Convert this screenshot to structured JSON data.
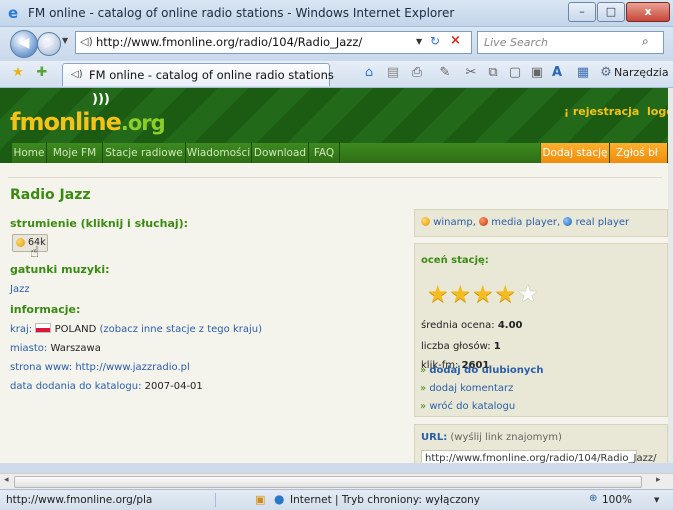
{
  "window": {
    "title": "FM online - catalog of online radio stations - Windows Internet Explorer",
    "minimize": "–",
    "maximize": "□",
    "close": "x"
  },
  "address_bar": {
    "back": "◀",
    "forward": "▶",
    "url": "http://www.fmonline.org/radio/104/Radio_Jazz/",
    "search_placeholder": "Live Search"
  },
  "command_bar": {
    "tab_title": "FM online - catalog of online radio stations",
    "tools_label": "Narzędzia"
  },
  "site": {
    "logo_fm": "fm",
    "logo_online": "online",
    "logo_org": ".org",
    "register": "rejestracja",
    "login": "logowa",
    "nav": [
      "Home",
      "Moje FM",
      "Stacje radiowe",
      "Wiadomości",
      "Download",
      "FAQ"
    ],
    "nav_right": [
      "Dodaj stację",
      "Zgłoś bł"
    ]
  },
  "station": {
    "title": "Radio Jazz",
    "stream_heading": "strumienie (kliknij i słuchaj):",
    "stream_button": "64k",
    "genre_heading": "gatunki muzyki:",
    "genre": "Jazz",
    "info_heading": "informacje:",
    "country_label": "kraj:",
    "country_value": "POLAND",
    "country_link": "(zobacz inne stacje z tego kraju)",
    "city_label": "miasto:",
    "city_value": "Warszawa",
    "website_label": "strona www:",
    "website_value": "http://www.jazzradio.pl",
    "date_label": "data dodania do katalogu:",
    "date_value": "2007-04-01"
  },
  "players": {
    "winamp": "winamp,",
    "media_player": "media player,",
    "real_player": "real player"
  },
  "rating": {
    "heading": "oceń stację:",
    "stars": 4,
    "stars_max": 5,
    "average_label": "średnia ocena:",
    "average_value": "4.00",
    "votes_label": "liczba głosów:",
    "votes_value": "1",
    "clicks_label": "klik-fm:",
    "clicks_value": "2601",
    "favorites_link": "dodaj do ulubionych",
    "comment_link": "dodaj komentarz",
    "catalog_link": "wróć do katalogu"
  },
  "share": {
    "label": "URL:",
    "hint": "(wyślij link znajomym)",
    "value": "http://www.fmonline.org/radio/104/Radio_Jazz/"
  },
  "status_bar": {
    "url": "http://www.fmonline.org/pla",
    "zone": "Internet | Tryb chroniony: wyłączony",
    "zoom": "100%"
  },
  "colors": {
    "brand_green": "#3b8b12",
    "logo_yellow": "#f5c218",
    "nav_orange": "#f5a21f",
    "link_blue": "#2a5ea8",
    "star_gold": "#f3bd22"
  }
}
